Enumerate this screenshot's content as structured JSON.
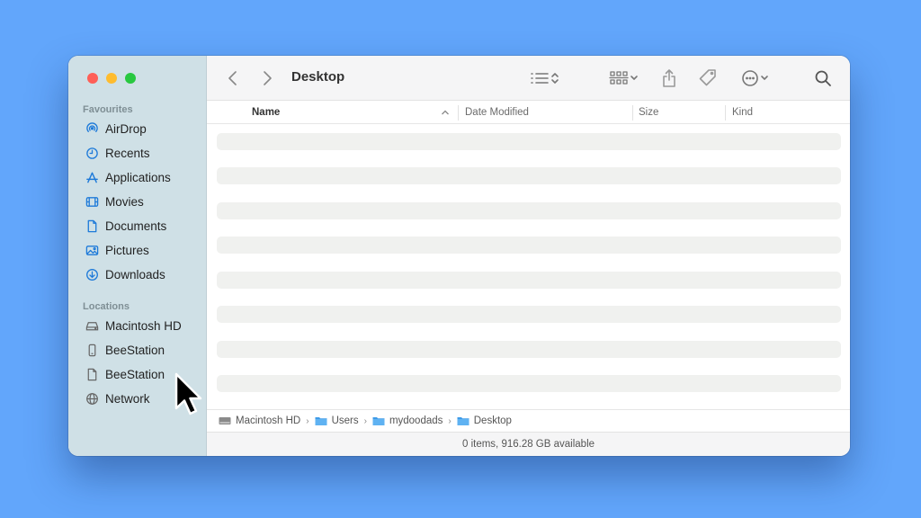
{
  "window": {
    "title": "Desktop"
  },
  "sidebar": {
    "favourites_heading": "Favourites",
    "favourites": [
      {
        "label": "AirDrop",
        "icon": "airdrop-icon"
      },
      {
        "label": "Recents",
        "icon": "clock-icon"
      },
      {
        "label": "Applications",
        "icon": "applications-icon"
      },
      {
        "label": "Movies",
        "icon": "film-icon"
      },
      {
        "label": "Documents",
        "icon": "document-icon"
      },
      {
        "label": "Pictures",
        "icon": "photo-icon"
      },
      {
        "label": "Downloads",
        "icon": "download-icon"
      }
    ],
    "locations_heading": "Locations",
    "locations": [
      {
        "label": "Macintosh HD",
        "icon": "harddrive-icon"
      },
      {
        "label": "BeeStation",
        "icon": "device-icon"
      },
      {
        "label": "BeeStation",
        "icon": "file-icon"
      },
      {
        "label": "Network",
        "icon": "globe-icon"
      }
    ]
  },
  "columns": {
    "name": "Name",
    "date_modified": "Date Modified",
    "size": "Size",
    "kind": "Kind"
  },
  "pathbar": {
    "crumbs": [
      {
        "label": "Macintosh HD",
        "icon": "harddrive-icon"
      },
      {
        "label": "Users",
        "icon": "folder-icon"
      },
      {
        "label": "mydoodads",
        "icon": "folder-icon"
      },
      {
        "label": "Desktop",
        "icon": "folder-icon"
      }
    ]
  },
  "status": {
    "text": "0 items, 916.28 GB available"
  },
  "colors": {
    "accent": "#1e7ad9",
    "background": "#62a6fb",
    "sidebar": "#cfe0e6"
  }
}
